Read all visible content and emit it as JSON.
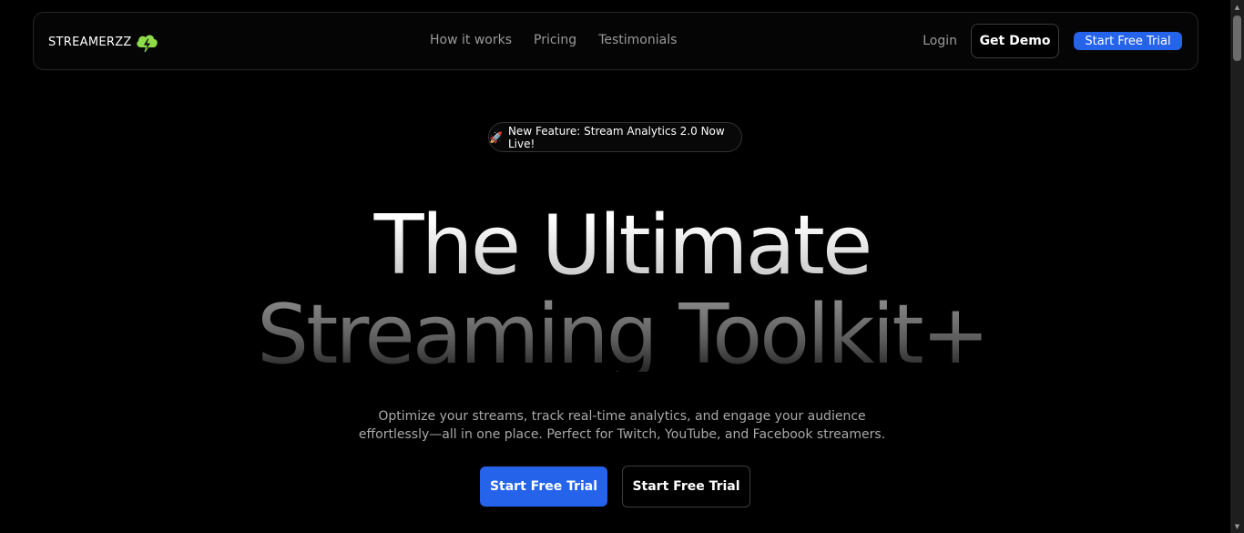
{
  "brand": {
    "name": "STREAMERZZ",
    "logo_icon": "cloud-lightning-icon",
    "logo_color": "#8fdc4a"
  },
  "nav": {
    "links": [
      "How it works",
      "Pricing",
      "Testimonials"
    ],
    "login": "Login",
    "demo": "Get Demo",
    "trial": "Start Free Trial"
  },
  "badge": {
    "icon": "🚀",
    "text": "New Feature: Stream Analytics 2.0 Now Live!"
  },
  "hero": {
    "line1": "The Ultimate",
    "line2": "Streaming Toolkit+",
    "subtitle": "Optimize your streams, track real-time analytics, and engage your audience effortlessly—all in one place. Perfect for Twitch, YouTube, and Facebook streamers.",
    "cta_primary": "Start Free Trial",
    "cta_secondary": "Start Free Trial"
  },
  "colors": {
    "accent": "#2563eb",
    "background": "#000000",
    "muted_text": "#9b9b9b"
  }
}
